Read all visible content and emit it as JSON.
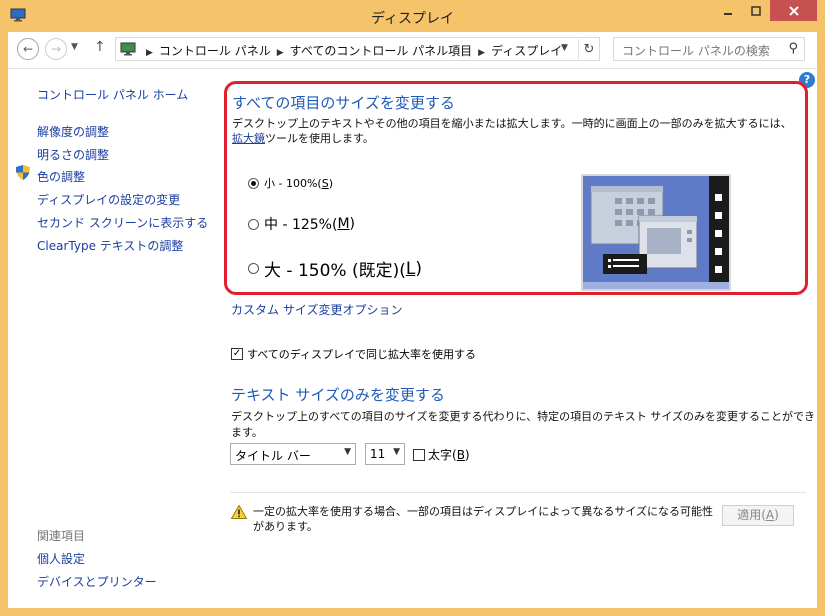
{
  "window": {
    "title": "ディスプレイ"
  },
  "nav": {
    "breadcrumbs": [
      "コントロール パネル",
      "すべてのコントロール パネル項目",
      "ディスプレイ"
    ],
    "search_placeholder": "コントロール パネルの検索"
  },
  "sidebar": {
    "home": "コントロール パネル ホーム",
    "items": [
      {
        "label": "解像度の調整"
      },
      {
        "label": "明るさの調整"
      },
      {
        "label": "色の調整"
      },
      {
        "label": "ディスプレイの設定の変更"
      },
      {
        "label": "セカンド スクリーンに表示する"
      },
      {
        "label": "ClearType テキストの調整"
      }
    ],
    "related_header": "関連項目",
    "related": [
      {
        "label": "個人設定"
      },
      {
        "label": "デバイスとプリンター"
      }
    ]
  },
  "main": {
    "heading1": "すべての項目のサイズを変更する",
    "desc1_pre": "デスクトップ上のテキストやその他の項目を縮小または拡大します。一時的に画面上の一部のみを拡大するには、",
    "desc1_link": "拡大鏡",
    "desc1_post": "ツールを使用します。",
    "size_options": [
      {
        "label": "小 - 100%(",
        "key": "S",
        "tail": ")",
        "selected": true
      },
      {
        "label": "中 - 125%(",
        "key": "M",
        "tail": ")",
        "selected": false
      },
      {
        "label": "大 - 150% (既定)(",
        "key": "L",
        "tail": ")",
        "selected": false
      }
    ],
    "custom_link": "カスタム サイズ変更オプション",
    "same_scale_label": "すべてのディスプレイで同じ拡大率を使用する",
    "same_scale_checked": true,
    "heading2": "テキスト サイズのみを変更する",
    "desc2": "デスクトップ上のすべての項目のサイズを変更する代わりに、特定の項目のテキスト サイズのみを変更することができます。",
    "item_select": "タイトル バー",
    "size_select": "11",
    "bold_label": "太字(",
    "bold_key": "B",
    "bold_tail": ")",
    "bold_checked": false,
    "warning": "一定の拡大率を使用する場合、一部の項目はディスプレイによって異なるサイズになる可能性があります。",
    "apply_label": "適用(",
    "apply_key": "A",
    "apply_tail": ")"
  },
  "colors": {
    "frame": "#F5C36A",
    "link": "#1A3E9E",
    "heading": "#1E5BB8",
    "highlight": "#E0202C",
    "close": "#C75050"
  }
}
